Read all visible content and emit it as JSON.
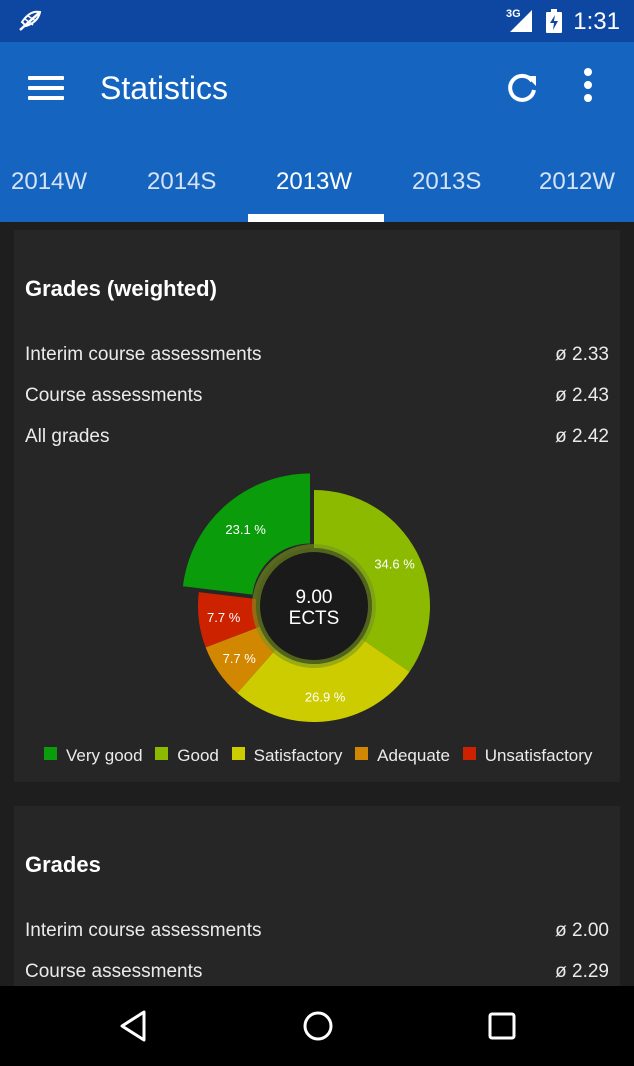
{
  "status_bar": {
    "time": "1:31",
    "network": "3G",
    "icons": [
      "app-notification-icon",
      "signal-icon",
      "battery-icon"
    ]
  },
  "app_bar": {
    "title": "Statistics",
    "icons": [
      "menu-icon",
      "refresh-icon",
      "more-vert-icon"
    ]
  },
  "tabs": [
    {
      "label": "2014W"
    },
    {
      "label": "2014S"
    },
    {
      "label": "2013W",
      "active": true
    },
    {
      "label": "2013S"
    },
    {
      "label": "2012W"
    }
  ],
  "cards": {
    "weighted": {
      "title": "Grades (weighted)",
      "rows": [
        {
          "label": "Interim course assessments",
          "value": "ø 2.33"
        },
        {
          "label": "Course assessments",
          "value": "ø 2.43"
        },
        {
          "label": "All grades",
          "value": "ø 2.42"
        }
      ]
    },
    "grades": {
      "title": "Grades",
      "rows": [
        {
          "label": "Interim course assessments",
          "value": "ø 2.00"
        },
        {
          "label": "Course assessments",
          "value": "ø 2.29"
        }
      ]
    }
  },
  "chart_data": {
    "type": "pie",
    "center_value": "9.00",
    "center_unit": "ECTS",
    "slices": [
      {
        "name": "Very good",
        "value": 23.1,
        "label": "23.1 %",
        "color": "#0a9c0a",
        "exploded": true
      },
      {
        "name": "Good",
        "value": 34.6,
        "label": "34.6 %",
        "color": "#8bba00"
      },
      {
        "name": "Satisfactory",
        "value": 26.9,
        "label": "26.9 %",
        "color": "#cccc00"
      },
      {
        "name": "Adequate",
        "value": 7.7,
        "label": "7.7 %",
        "color": "#d18700"
      },
      {
        "name": "Unsatisfactory",
        "value": 7.7,
        "label": "7.7 %",
        "color": "#cc2200"
      }
    ],
    "slice_order": [
      "Good",
      "Satisfactory",
      "Adequate",
      "Unsatisfactory",
      "Very good"
    ],
    "legend": [
      "Very good",
      "Good",
      "Satisfactory",
      "Adequate",
      "Unsatisfactory"
    ]
  },
  "nav_bar": {
    "icons": [
      "back-icon",
      "home-icon",
      "recents-icon"
    ]
  },
  "colors": {
    "status_bar": "#0d47a1",
    "app_bar": "#1565c0",
    "card": "#262626",
    "background": "#1e1e1e"
  }
}
